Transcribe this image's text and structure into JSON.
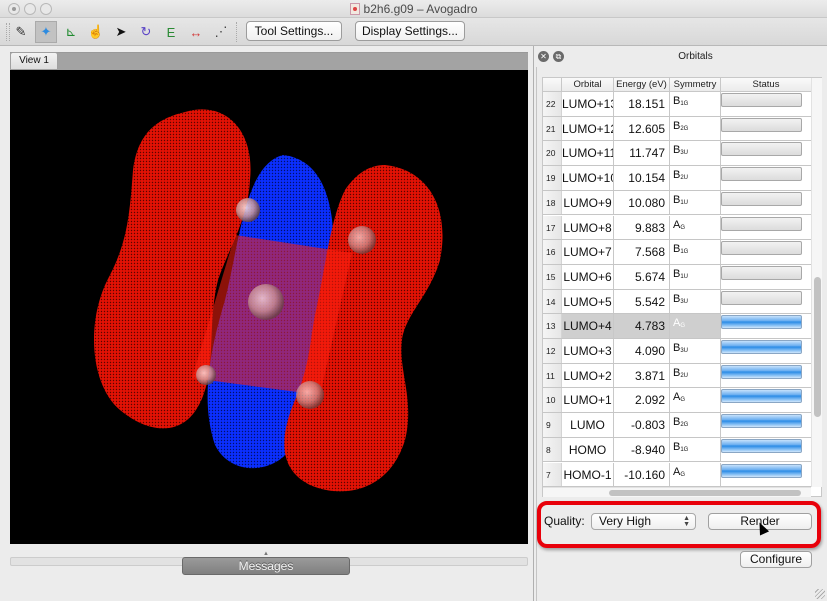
{
  "window": {
    "title": "b2h6.g09 – Avogadro"
  },
  "toolbar": {
    "tools": [
      {
        "name": "draw-tool",
        "glyph": "✎",
        "color": "#333333",
        "active": false
      },
      {
        "name": "navigate-tool",
        "glyph": "✦",
        "color": "#2d8be0",
        "active": true
      },
      {
        "name": "bond-centric-tool",
        "glyph": "⊾",
        "color": "#1f8a2e",
        "active": false
      },
      {
        "name": "manipulate-tool",
        "glyph": "☝",
        "color": "#555555",
        "active": false
      },
      {
        "name": "select-tool",
        "glyph": "➤",
        "color": "#111111",
        "active": false
      },
      {
        "name": "auto-rotate-tool",
        "glyph": "↻",
        "color": "#5a43c6",
        "active": false
      },
      {
        "name": "auto-optimize-tool",
        "glyph": "E",
        "color": "#2a8a34",
        "active": false
      },
      {
        "name": "measure-tool",
        "glyph": "↔",
        "color": "#d23a3a",
        "active": false
      },
      {
        "name": "align-tool",
        "glyph": "⋰",
        "color": "#444444",
        "active": false
      }
    ],
    "tool_settings_label": "Tool Settings...",
    "display_settings_label": "Display Settings..."
  },
  "view": {
    "tab_label": "View 1",
    "positive_lobe_color": "#ff1a0a",
    "negative_lobe_color": "#0a2cff",
    "background_color": "#000000"
  },
  "messages": {
    "label": "Messages"
  },
  "orbitals_panel": {
    "title": "Orbitals",
    "columns": [
      "Orbital",
      "Energy (eV)",
      "Symmetry",
      "Status"
    ],
    "rows": [
      {
        "num": "22",
        "orbital": "LUMO+13",
        "energy": "18.151",
        "sym": "B",
        "sym_sub": "1G",
        "rendered": false,
        "selected": false
      },
      {
        "num": "21",
        "orbital": "LUMO+12",
        "energy": "12.605",
        "sym": "B",
        "sym_sub": "2G",
        "rendered": false,
        "selected": false
      },
      {
        "num": "20",
        "orbital": "LUMO+11",
        "energy": "11.747",
        "sym": "B",
        "sym_sub": "3U",
        "rendered": false,
        "selected": false
      },
      {
        "num": "19",
        "orbital": "LUMO+10",
        "energy": "10.154",
        "sym": "B",
        "sym_sub": "2U",
        "rendered": false,
        "selected": false
      },
      {
        "num": "18",
        "orbital": "LUMO+9",
        "energy": "10.080",
        "sym": "B",
        "sym_sub": "1U",
        "rendered": false,
        "selected": false
      },
      {
        "num": "17",
        "orbital": "LUMO+8",
        "energy": "9.883",
        "sym": "A",
        "sym_sub": "G",
        "rendered": false,
        "selected": false
      },
      {
        "num": "16",
        "orbital": "LUMO+7",
        "energy": "7.568",
        "sym": "B",
        "sym_sub": "1G",
        "rendered": false,
        "selected": false
      },
      {
        "num": "15",
        "orbital": "LUMO+6",
        "energy": "5.674",
        "sym": "B",
        "sym_sub": "1U",
        "rendered": false,
        "selected": false
      },
      {
        "num": "14",
        "orbital": "LUMO+5",
        "energy": "5.542",
        "sym": "B",
        "sym_sub": "3U",
        "rendered": false,
        "selected": false
      },
      {
        "num": "13",
        "orbital": "LUMO+4",
        "energy": "4.783",
        "sym": "A",
        "sym_sub": "G",
        "rendered": true,
        "selected": true
      },
      {
        "num": "12",
        "orbital": "LUMO+3",
        "energy": "4.090",
        "sym": "B",
        "sym_sub": "3U",
        "rendered": true,
        "selected": false
      },
      {
        "num": "11",
        "orbital": "LUMO+2",
        "energy": "3.871",
        "sym": "B",
        "sym_sub": "2U",
        "rendered": true,
        "selected": false
      },
      {
        "num": "10",
        "orbital": "LUMO+1",
        "energy": "2.092",
        "sym": "A",
        "sym_sub": "G",
        "rendered": true,
        "selected": false
      },
      {
        "num": "9",
        "orbital": "LUMO",
        "energy": "-0.803",
        "sym": "B",
        "sym_sub": "2G",
        "rendered": true,
        "selected": false
      },
      {
        "num": "8",
        "orbital": "HOMO",
        "energy": "-8.940",
        "sym": "B",
        "sym_sub": "1G",
        "rendered": true,
        "selected": false
      },
      {
        "num": "7",
        "orbital": "HOMO-1",
        "energy": "-10.160",
        "sym": "A",
        "sym_sub": "G",
        "rendered": true,
        "selected": false
      }
    ],
    "quality_label": "Quality:",
    "quality_value": "Very High",
    "render_label": "Render",
    "configure_label": "Configure",
    "highlight_color": "#e8000a"
  }
}
